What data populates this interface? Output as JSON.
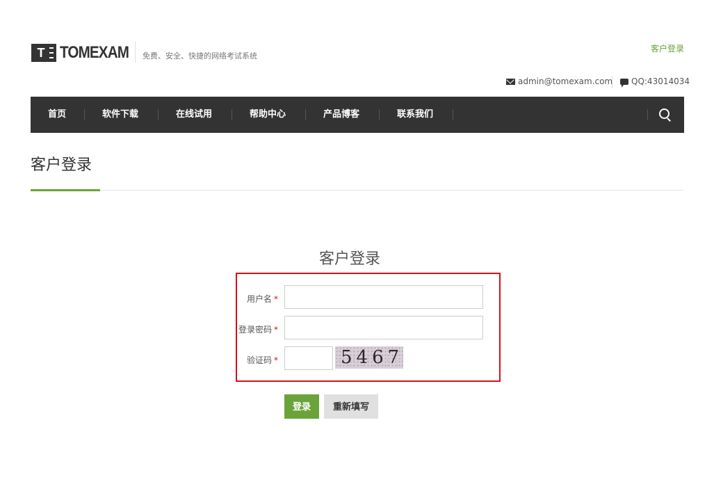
{
  "header": {
    "logo_mark": "T",
    "logo_text": "TOMEXAM",
    "slogan": "免费、安全、快捷的网络考试系统",
    "top_login": "客户登录",
    "email": "admin@tomexam.com",
    "qq": "QQ:43014034"
  },
  "nav": {
    "items": [
      "首页",
      "软件下载",
      "在线试用",
      "帮助中心",
      "产品博客",
      "联系我们"
    ]
  },
  "page": {
    "title": "客户登录"
  },
  "form": {
    "title": "客户登录",
    "username_label": "用户名",
    "password_label": "登录密码",
    "captcha_label": "验证码",
    "required_mark": "*",
    "username_value": "",
    "password_value": "",
    "captcha_value": "",
    "captcha_text": "5467",
    "login_button": "登录",
    "reset_button": "重新填写"
  },
  "colors": {
    "accent": "#6aa33a",
    "nav_bg": "#333333",
    "highlight": "#d0121b"
  }
}
